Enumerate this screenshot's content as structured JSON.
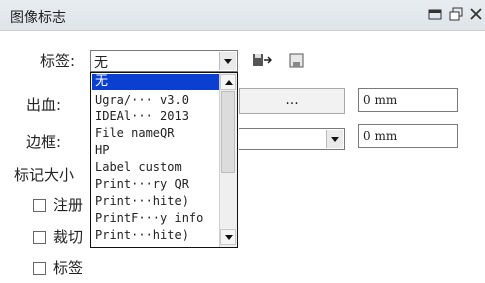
{
  "panel": {
    "title": "图像标志",
    "title_icons": [
      "menu-icon",
      "restore-icon",
      "close-icon"
    ]
  },
  "label_row": {
    "label": "标签:",
    "combo_value": "无",
    "icons": [
      "import-icon",
      "save-icon"
    ]
  },
  "bleed": {
    "label": "出血:",
    "browse_label": "...",
    "value": "0 mm"
  },
  "border": {
    "label": "边框:",
    "value": "0 mm"
  },
  "mark_size": {
    "label": "标记大小"
  },
  "checkboxes": [
    {
      "label": "注册",
      "checked": false
    },
    {
      "label": "裁切",
      "checked": false
    },
    {
      "label": "标签",
      "checked": false
    }
  ],
  "dropdown": {
    "items": [
      "无",
      "Ugra/··· v3.0",
      "IDEAl··· 2013",
      "File nameQR",
      "HP",
      "Label custom",
      "Print···ry QR",
      "Print···hite)",
      "PrintF···y info",
      "Print···hite)"
    ],
    "selected_index": 0
  }
}
